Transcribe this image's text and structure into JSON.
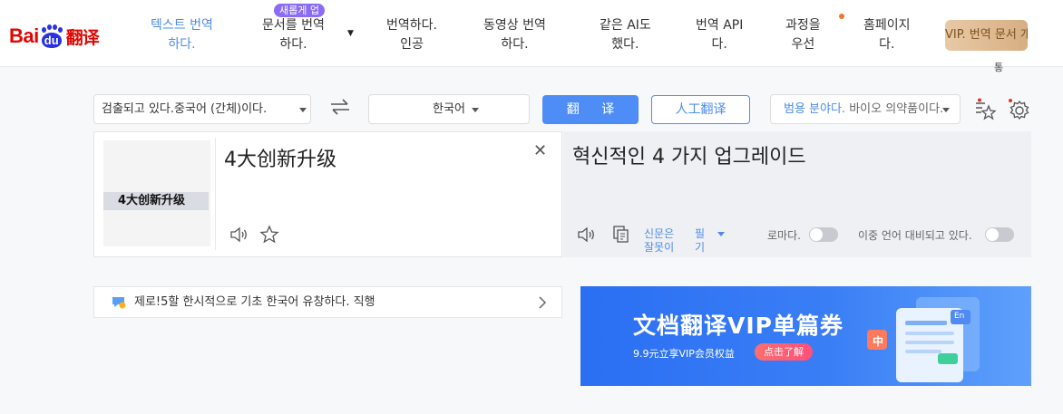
{
  "header": {
    "logo_text": "Bai",
    "logo_du": "du",
    "logo_cn": "翻译",
    "nav": [
      {
        "line1": "텍스트 번역",
        "line2": "하다."
      },
      {
        "line1": "문서를 번역",
        "line2": "하다."
      },
      {
        "line1": "번역하다.",
        "line2": "인공"
      },
      {
        "line1": "동영상 번역",
        "line2": "하다."
      },
      {
        "line1": "같은 AI도",
        "line2": "했다."
      },
      {
        "line1": "번역 API",
        "line2": "다."
      },
      {
        "line1": "과정을",
        "line2": "우선"
      },
      {
        "line1": "홈페이지",
        "line2": "다."
      }
    ],
    "new_badge": "새롭게 업",
    "vip_label": "VIP. 번역 문서 개",
    "vip_extra": "통",
    "colors": {
      "active": "#4e8ce7",
      "badge": "#8a6cf5",
      "brand_red": "#e10601",
      "brand_blue": "#2932e1"
    }
  },
  "toolbar": {
    "source_lang": "검출되고 있다.중국어 (간체)이다.",
    "target_lang": "한국어",
    "translate_label": "翻 译",
    "human_translate_label": "人工翻译",
    "domain_label": "범용 분야다.",
    "domain_value": "바이오 의약품이다.",
    "icons": [
      "swap-icon",
      "favorites-icon",
      "settings-icon"
    ]
  },
  "source": {
    "text": "4大创新升级",
    "thumbnail_text": "4大创新升级"
  },
  "target": {
    "text": "혁신적인 4 가지 업그레이드",
    "feedback_label_1": "신문은",
    "feedback_label_2": "잘못이",
    "note_label_1": "필",
    "note_label_2": "기",
    "romaji_label": "로마다.",
    "bilingual_label": "이중 언어 대비되고 있다."
  },
  "tip": {
    "text": "제로!5할 한시적으로 기초 한국어 유창하다. 직행"
  },
  "ad": {
    "title": "文档翻译VIP单篇券",
    "subtitle": "9.9元立享VIP会员权益",
    "button": "点击了解",
    "tag_zh": "中",
    "tag_en": "En"
  }
}
